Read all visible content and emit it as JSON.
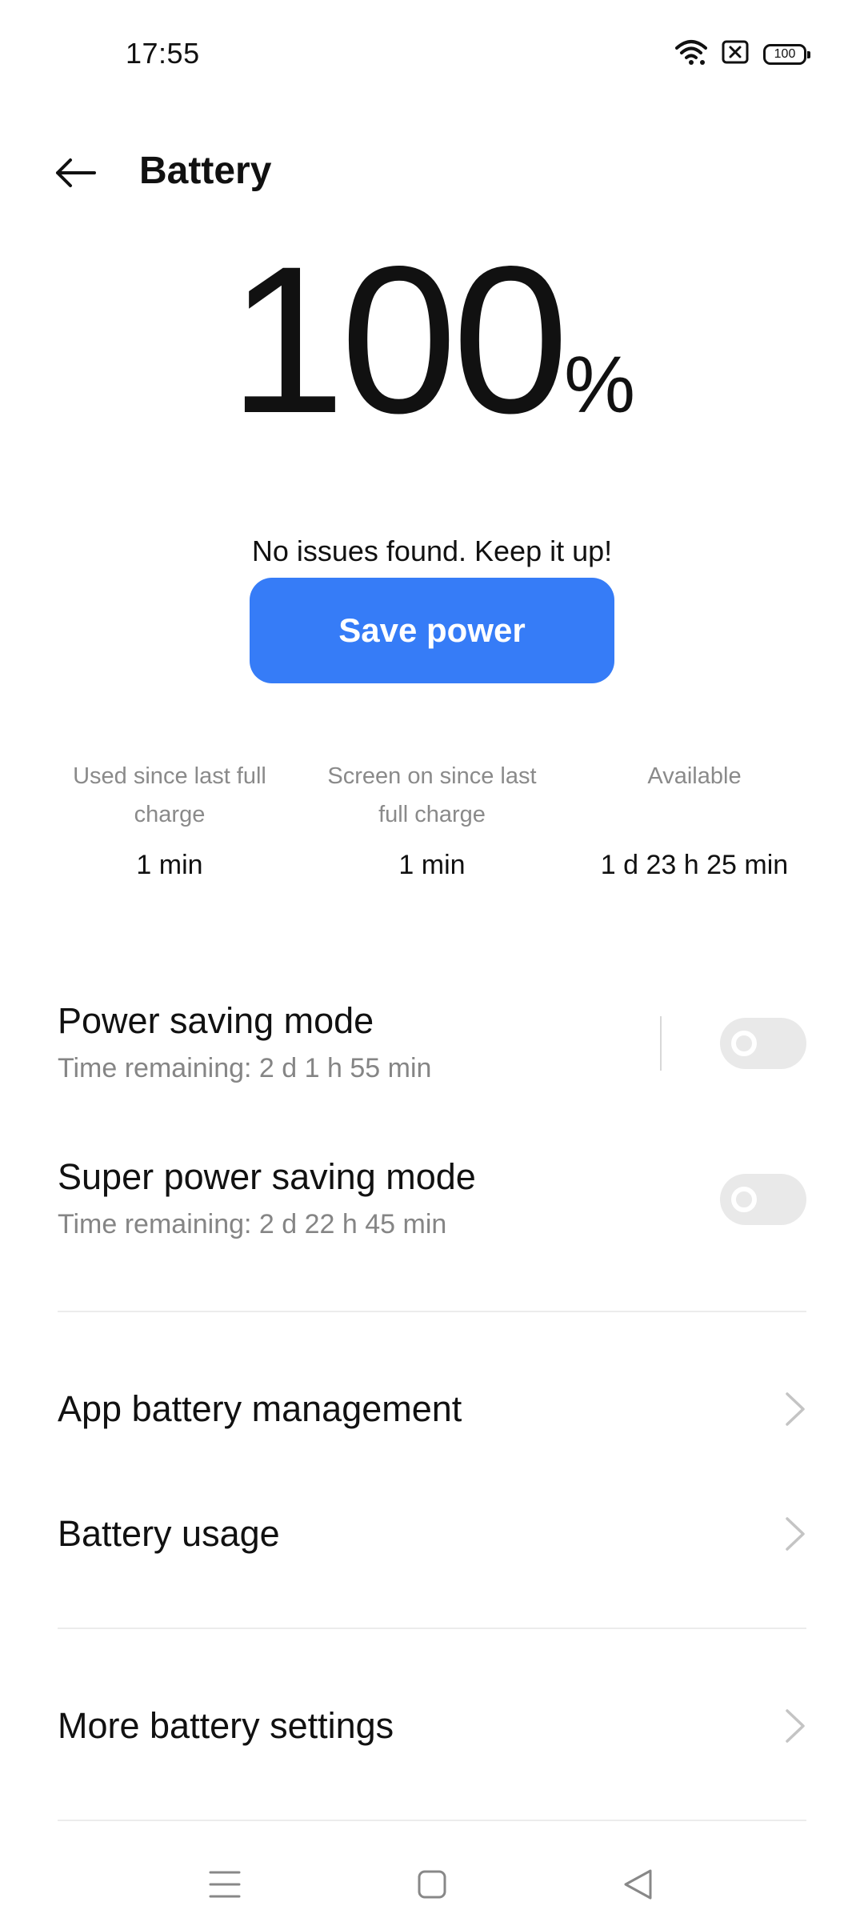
{
  "status_bar": {
    "time": "17:55",
    "battery_level": "100",
    "icons": [
      "wifi-icon",
      "sim-error-icon",
      "battery-icon"
    ]
  },
  "header": {
    "title": "Battery",
    "back_icon": "back-arrow-icon"
  },
  "battery": {
    "percent": "100",
    "unit": "%",
    "message": "No issues found. Keep it up!"
  },
  "save_power": {
    "label": "Save power",
    "color": "#367cf7"
  },
  "stats": [
    {
      "label": "Used since last full charge",
      "value": "1 min"
    },
    {
      "label": "Screen on since last full charge",
      "value": "1 min"
    },
    {
      "label": "Available",
      "value": "1 d 23 h 25 min"
    }
  ],
  "modes": [
    {
      "title": "Power saving mode",
      "subtitle": "Time remaining:  2 d 1 h 55 min",
      "enabled": false
    },
    {
      "title": "Super power saving mode",
      "subtitle": "Time remaining:  2 d 22 h 45 min",
      "enabled": false
    }
  ],
  "menu": [
    {
      "label": "App battery management",
      "icon": "chevron-right-icon"
    },
    {
      "label": "Battery usage",
      "icon": "chevron-right-icon"
    },
    {
      "label": "More battery settings",
      "icon": "chevron-right-icon"
    }
  ],
  "navbar": {
    "icons": [
      "menu-icon",
      "home-icon",
      "back-triangle-icon"
    ]
  }
}
